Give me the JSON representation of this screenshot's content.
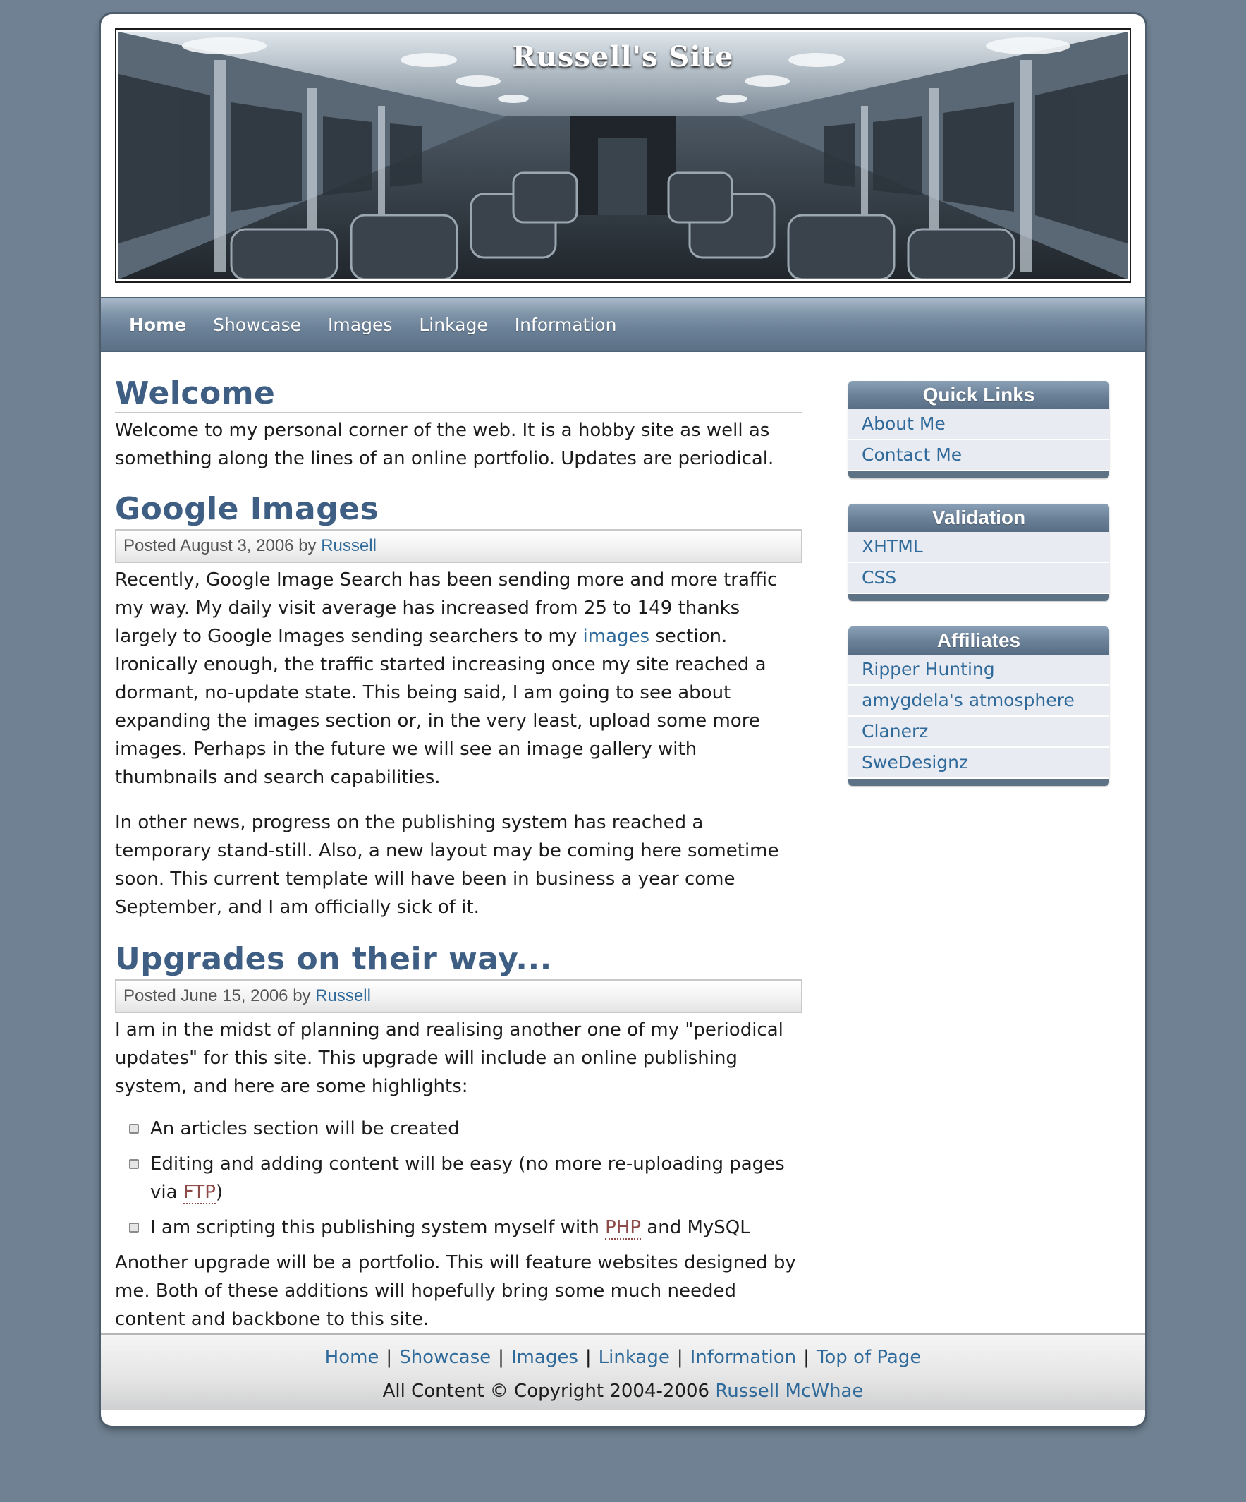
{
  "header": {
    "site_title": "Russell's Site"
  },
  "nav": {
    "items": [
      "Home",
      "Showcase",
      "Images",
      "Linkage",
      "Information"
    ],
    "active": "Home"
  },
  "welcome": {
    "heading": "Welcome",
    "text": "Welcome to my personal corner of the web. It is a hobby site as well as something along the lines of an online portfolio. Updates are periodical."
  },
  "posts": [
    {
      "title": "Google Images",
      "posted_prefix": "Posted August 3, 2006 by",
      "author": "Russell",
      "para1_a": "Recently, Google Image Search has been sending more and more traffic my way. My daily visit average has increased from 25 to 149 thanks largely to Google Images sending searchers to my",
      "para1_link": "images",
      "para1_b": "section. Ironically enough, the traffic started increasing once my site reached a dormant, no-update state. This being said, I am going to see about expanding the images section or, in the very least, upload some more images. Perhaps in the future we will see an image gallery with thumbnails and search capabilities.",
      "para2": "In other news, progress on the publishing system has reached a temporary stand-still. Also, a new layout may be coming here sometime soon. This current template will have been in business a year come September, and I am officially sick of it."
    },
    {
      "title": "Upgrades on their way...",
      "posted_prefix": "Posted June 15, 2006 by",
      "author": "Russell",
      "intro": "I am in the midst of planning and realising another one of my \"periodical updates\" for this site. This upgrade will include an online publishing system, and here are some highlights:",
      "bullets": {
        "b1": "An articles section will be created",
        "b2_a": "Editing and adding content will be easy (no more re-uploading pages via",
        "b2_abbr": "FTP",
        "b2_b": ")",
        "b3_a": "I am scripting this publishing system myself with",
        "b3_abbr": "PHP",
        "b3_b": "and MySQL"
      },
      "outro": "Another upgrade will be a portfolio. This will feature websites designed by me. Both of these additions will hopefully bring some much needed content and backbone to this site."
    }
  ],
  "sidebar": {
    "quick_links": {
      "title": "Quick Links",
      "items": [
        "About Me",
        "Contact Me"
      ]
    },
    "validation": {
      "title": "Validation",
      "items": [
        "XHTML",
        "CSS"
      ]
    },
    "affiliates": {
      "title": "Affiliates",
      "items": [
        "Ripper Hunting",
        "amygdela's atmosphere",
        "Clanerz",
        "SweDesignz"
      ]
    }
  },
  "footer": {
    "links": [
      "Home",
      "Showcase",
      "Images",
      "Linkage",
      "Information",
      "Top of Page"
    ],
    "separator": "|",
    "copyright_prefix": "All Content © Copyright 2004-2006",
    "copyright_owner": "Russell McWhae"
  },
  "colors": {
    "background": "#6f8192",
    "heading": "#3e5e84",
    "link": "#2f6a9a",
    "nav": "#6a8097",
    "abbr": "#8c4b48"
  }
}
